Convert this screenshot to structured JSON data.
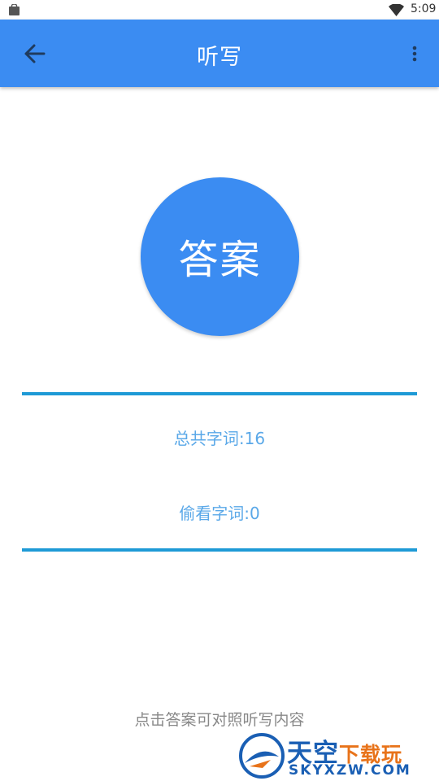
{
  "status_bar": {
    "time": "5:09"
  },
  "app_bar": {
    "title": "听写"
  },
  "answer_button": {
    "label": "答案"
  },
  "stats": {
    "total_words": "总共字词:16",
    "peeked_words": "偷看字词:0"
  },
  "hint": "点击答案可对照听写内容",
  "watermark": {
    "name_main": "天空",
    "name_accent": "下载玩",
    "domain": "SKYXZW.COM"
  },
  "colors": {
    "primary": "#3b8cf2",
    "divider": "#1e9ad6",
    "stat_text": "#5aa8e8",
    "hint_text": "#888888"
  }
}
